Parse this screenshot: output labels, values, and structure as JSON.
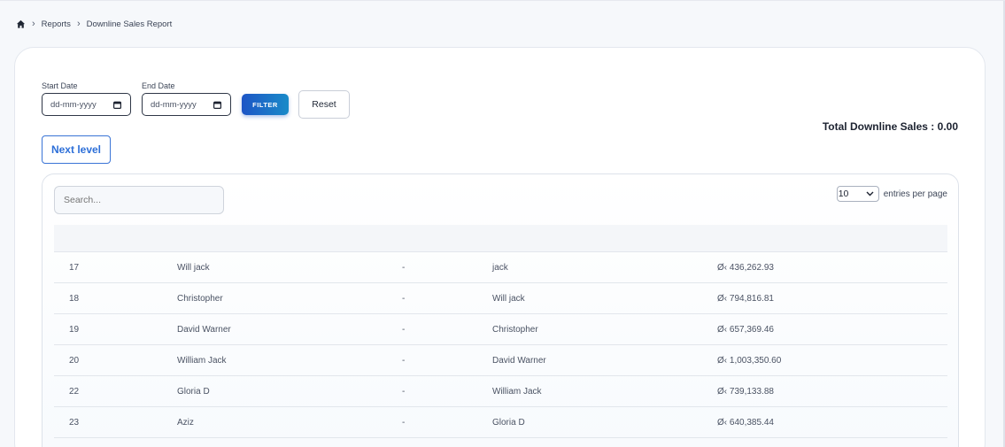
{
  "breadcrumb": {
    "home_icon": "home-icon",
    "items": [
      "Reports",
      "Downline Sales Report"
    ]
  },
  "filters": {
    "start_label": "Start Date",
    "start_placeholder": "dd-mm-yyyy",
    "end_label": "End Date",
    "end_placeholder": "dd-mm-yyyy",
    "filter_button": "FILTER",
    "reset_button": "Reset"
  },
  "summary": {
    "total_label": "Total Downline Sales : 0.00"
  },
  "next_level_button": "Next level",
  "table": {
    "search_placeholder": "Search...",
    "entries_value": "10",
    "entries_label": "entries per page",
    "rows": [
      {
        "id": "17",
        "name": "Will jack",
        "dash": "-",
        "parent": "jack",
        "amount": "Ø‹ 436,262.93"
      },
      {
        "id": "18",
        "name": "Christopher",
        "dash": "-",
        "parent": "Will jack",
        "amount": "Ø‹ 794,816.81"
      },
      {
        "id": "19",
        "name": "David Warner",
        "dash": "-",
        "parent": "Christopher",
        "amount": "Ø‹ 657,369.46"
      },
      {
        "id": "20",
        "name": "William Jack",
        "dash": "-",
        "parent": "David Warner",
        "amount": "Ø‹ 1,003,350.60"
      },
      {
        "id": "22",
        "name": "Gloria D",
        "dash": "-",
        "parent": "William Jack",
        "amount": "Ø‹ 739,133.88"
      },
      {
        "id": "23",
        "name": "Aziz",
        "dash": "-",
        "parent": "Gloria D",
        "amount": "Ø‹ 640,385.44"
      }
    ]
  },
  "colors": {
    "accent_blue": "#1d55c6",
    "accent_teal": "#1a8bc8",
    "page_bg": "#f6f8fb"
  }
}
